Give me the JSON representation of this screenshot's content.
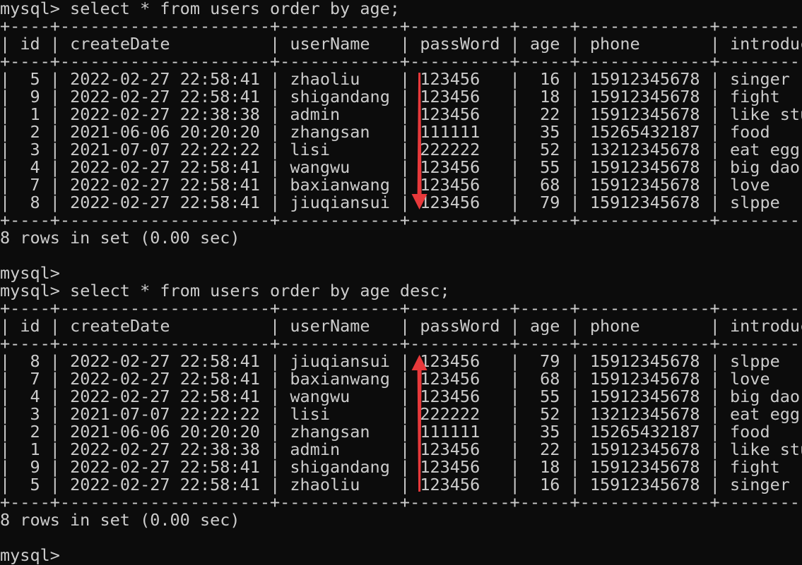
{
  "prompt": "mysql>",
  "queries": [
    {
      "command": "select * from users order by age;",
      "columns": [
        "id",
        "createDate",
        "userName",
        "passWord",
        "age",
        "phone",
        "introduce"
      ],
      "rows": [
        [
          "5",
          "2022-02-27 22:58:41",
          "zhaoliu",
          "123456",
          "16",
          "15912345678",
          "singer"
        ],
        [
          "9",
          "2022-02-27 22:58:41",
          "shigandang",
          "123456",
          "18",
          "15912345678",
          "fight"
        ],
        [
          "1",
          "2022-02-27 22:38:38",
          "admin",
          "123456",
          "22",
          "15912345678",
          "like study."
        ],
        [
          "2",
          "2021-06-06 20:20:20",
          "zhangsan",
          "111111",
          "35",
          "15265432187",
          "food"
        ],
        [
          "3",
          "2021-07-07 22:22:22",
          "lisi",
          "222222",
          "52",
          "13212345678",
          "eat egg"
        ],
        [
          "4",
          "2022-02-27 22:58:41",
          "wangwu",
          "123456",
          "55",
          "15912345678",
          "big dao"
        ],
        [
          "7",
          "2022-02-27 22:58:41",
          "baxianwang",
          "123456",
          "68",
          "15912345678",
          "love"
        ],
        [
          "8",
          "2022-02-27 22:58:41",
          "jiuqiansui",
          "123456",
          "79",
          "15912345678",
          "slppe"
        ]
      ],
      "result": "8 rows in set (0.00 sec)",
      "arrow": "down"
    },
    {
      "command": "select * from users order by age desc;",
      "columns": [
        "id",
        "createDate",
        "userName",
        "passWord",
        "age",
        "phone",
        "introduce"
      ],
      "rows": [
        [
          "8",
          "2022-02-27 22:58:41",
          "jiuqiansui",
          "123456",
          "79",
          "15912345678",
          "slppe"
        ],
        [
          "7",
          "2022-02-27 22:58:41",
          "baxianwang",
          "123456",
          "68",
          "15912345678",
          "love"
        ],
        [
          "4",
          "2022-02-27 22:58:41",
          "wangwu",
          "123456",
          "55",
          "15912345678",
          "big dao"
        ],
        [
          "3",
          "2021-07-07 22:22:22",
          "lisi",
          "222222",
          "52",
          "13212345678",
          "eat egg"
        ],
        [
          "2",
          "2021-06-06 20:20:20",
          "zhangsan",
          "111111",
          "35",
          "15265432187",
          "food"
        ],
        [
          "1",
          "2022-02-27 22:38:38",
          "admin",
          "123456",
          "22",
          "15912345678",
          "like study."
        ],
        [
          "9",
          "2022-02-27 22:58:41",
          "shigandang",
          "123456",
          "18",
          "15912345678",
          "fight"
        ],
        [
          "5",
          "2022-02-27 22:58:41",
          "zhaoliu",
          "123456",
          "16",
          "15912345678",
          "singer"
        ]
      ],
      "result": "8 rows in set (0.00 sec)",
      "arrow": "up"
    }
  ],
  "colors": {
    "background": "#0c0c0c",
    "text": "#cccccc",
    "annotation_arrow": "#e8393b"
  }
}
